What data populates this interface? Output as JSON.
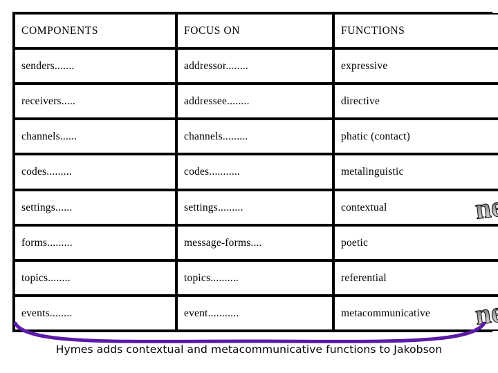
{
  "slide": {
    "background_color": "#ffffff",
    "accent_color": "#5B1BA8",
    "text_color": "#000000"
  },
  "table": {
    "headers": [
      "COMPONENTS",
      "FOCUS ON",
      "FUNCTIONS"
    ],
    "rows": [
      {
        "components": "senders.......",
        "focus_on": "addressor........",
        "functions": "expressive",
        "badge": ""
      },
      {
        "components": "receivers.....",
        "focus_on": "addressee........",
        "functions": "directive",
        "badge": ""
      },
      {
        "components": "channels......",
        "focus_on": "channels.........",
        "functions": "phatic (contact)",
        "badge": ""
      },
      {
        "components": "codes.........",
        "focus_on": "codes...........",
        "functions": "metalinguistic",
        "badge": ""
      },
      {
        "components": "settings......",
        "focus_on": "settings.........",
        "functions": "contextual",
        "badge": "new"
      },
      {
        "components": "forms.........",
        "focus_on": "message-forms....",
        "functions": "poetic",
        "badge": ""
      },
      {
        "components": "topics........",
        "focus_on": "topics..........",
        "functions": "referential",
        "badge": ""
      },
      {
        "components": "events........",
        "focus_on": "event...........",
        "functions": "metacommunicative",
        "badge": "new"
      }
    ]
  },
  "badges": {
    "new_label": "new"
  },
  "caption": {
    "text": "Hymes adds contextual and metacommunicative functions to Jakobson"
  },
  "decorations": {
    "swoosh_name": "purple-swoosh-underline",
    "swoosh_color": "#5B1BA8"
  }
}
